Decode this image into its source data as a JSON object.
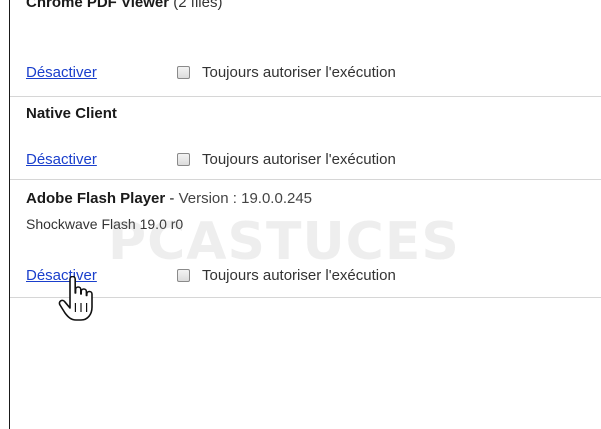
{
  "plugins": [
    {
      "name": "Chrome PDF Viewer",
      "meta": "(2 files)",
      "disable_label": "Désactiver",
      "always_allow_label": "Toujours autoriser l'exécution",
      "always_allow_checked": false
    },
    {
      "name": "Native Client",
      "disable_label": "Désactiver",
      "always_allow_label": "Toujours autoriser l'exécution",
      "always_allow_checked": false
    },
    {
      "name": "Adobe Flash Player",
      "separator": " - ",
      "version_label": "Version : ",
      "version": "19.0.0.245",
      "description": "Shockwave Flash 19.0 r0",
      "disable_label": "Désactiver",
      "always_allow_label": "Toujours autoriser l'exécution",
      "always_allow_checked": false
    }
  ],
  "watermark": "PCASTUCES",
  "colors": {
    "link": "#1a3fcc",
    "divider": "#d6d6d6",
    "text": "#333333"
  },
  "cursor": "hand-pointer-icon"
}
